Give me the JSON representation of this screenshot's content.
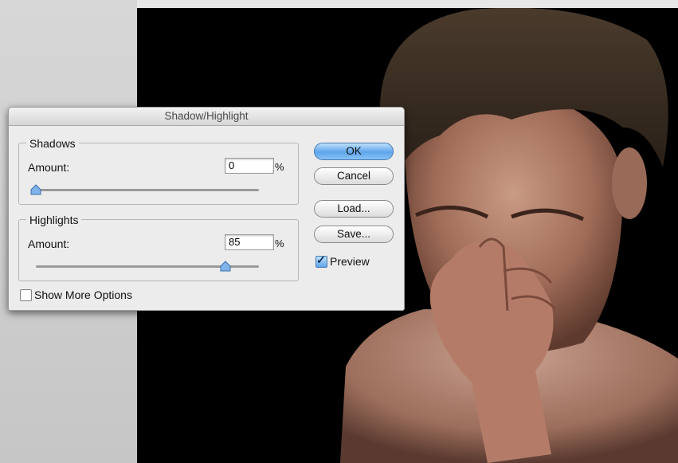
{
  "dialog": {
    "title": "Shadow/Highlight",
    "shadows": {
      "group_label": "Shadows",
      "amount_label": "Amount:",
      "amount_value": "0",
      "unit": "%",
      "slider_level": 0.0
    },
    "highlights": {
      "group_label": "Highlights",
      "amount_label": "Amount:",
      "amount_value": "85",
      "unit": "%",
      "slider_level": 0.85
    },
    "buttons": {
      "ok": "OK",
      "cancel": "Cancel",
      "load": "Load...",
      "save": "Save..."
    },
    "preview": {
      "label": "Preview",
      "checked": true
    },
    "show_more_options": {
      "label": "Show More Options",
      "checked": false
    }
  },
  "colors": {
    "accent": "#5ea6ec",
    "canvas_background": "#000000",
    "dialog_background": "#ececec"
  }
}
